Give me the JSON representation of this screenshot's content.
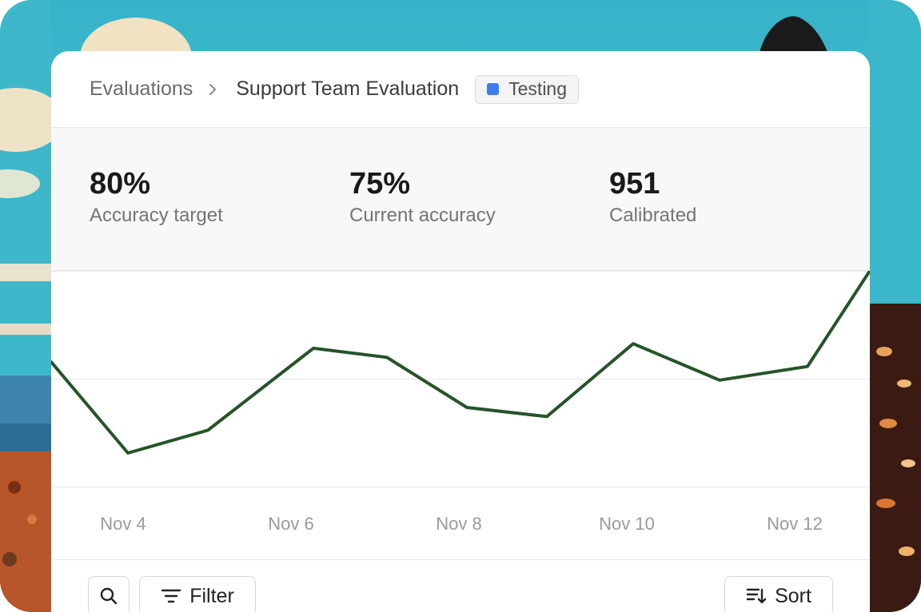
{
  "breadcrumb": {
    "parent": "Evaluations",
    "current": "Support Team Evaluation"
  },
  "status_badge": {
    "label": "Testing",
    "color": "#3b7ded"
  },
  "stats": [
    {
      "value": "80%",
      "label": "Accuracy target"
    },
    {
      "value": "75%",
      "label": "Current accuracy"
    },
    {
      "value": "951",
      "label": "Calibrated"
    }
  ],
  "chart_data": {
    "type": "line",
    "x_tick_labels": [
      "Nov 4",
      "Nov 6",
      "Nov 8",
      "Nov 10",
      "Nov 12"
    ],
    "series": [
      {
        "color": "#255428",
        "values": [
          0.79,
          0.59,
          0.64,
          0.82,
          0.8,
          0.69,
          0.67,
          0.83,
          0.75,
          0.78,
          0.99
        ]
      }
    ],
    "grid": "horizontal"
  },
  "toolbar": {
    "filter_label": "Filter",
    "sort_label": "Sort"
  },
  "icons": {
    "search": "search-icon",
    "filter": "filter-icon",
    "sort": "sort-icon",
    "chevron": "chevron-right-icon"
  }
}
